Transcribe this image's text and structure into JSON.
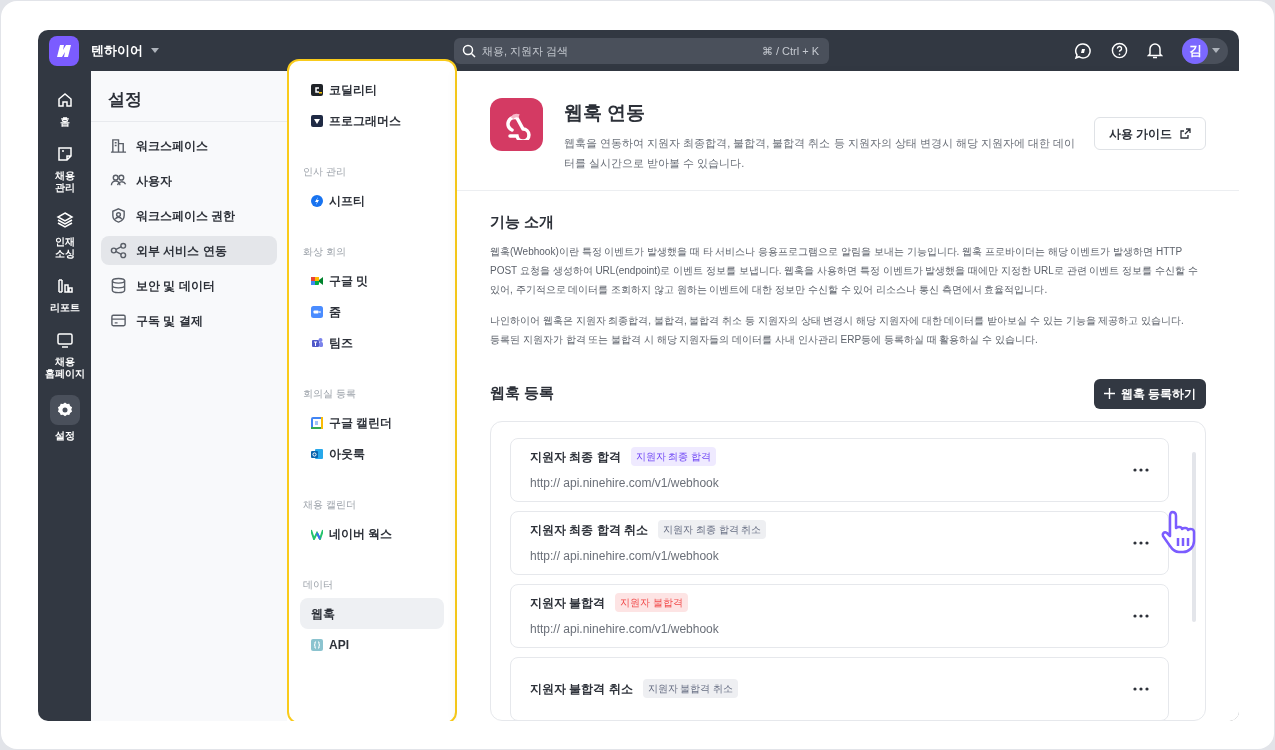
{
  "top_bar": {
    "workspace": "텐하이어",
    "search": {
      "placeholder": "채용, 지원자 검색",
      "shortcut": "⌘ / Ctrl + K"
    },
    "avatar": "김"
  },
  "rail": [
    {
      "label": "홈",
      "selected": false
    },
    {
      "label": "채용 관리",
      "selected": false
    },
    {
      "label": "인재 소싱",
      "selected": false
    },
    {
      "label": "리포트",
      "selected": false
    },
    {
      "label": "채용 홈페이지",
      "selected": false
    },
    {
      "label": "설정",
      "selected": true
    }
  ],
  "settings": {
    "title": "설정",
    "items": [
      {
        "label": "워크스페이스",
        "selected": false
      },
      {
        "label": "사용자",
        "selected": false
      },
      {
        "label": "워크스페이스 권한",
        "selected": false
      },
      {
        "label": "외부 서비스 연동",
        "selected": true
      },
      {
        "label": "보안 및 데이터",
        "selected": false
      },
      {
        "label": "구독 및 결제",
        "selected": false
      }
    ]
  },
  "integrations": [
    {
      "items": [
        {
          "label": "코딜리티",
          "selected": false
        },
        {
          "label": "프로그래머스",
          "selected": false
        }
      ]
    },
    {
      "heading": "인사 관리",
      "items": [
        {
          "label": "시프티",
          "selected": false
        }
      ]
    },
    {
      "heading": "화상 회의",
      "items": [
        {
          "label": "구글 밋",
          "selected": false
        },
        {
          "label": "줌",
          "selected": false
        },
        {
          "label": "팀즈",
          "selected": false
        }
      ]
    },
    {
      "heading": "회의실 등록",
      "items": [
        {
          "label": "구글 캘린더",
          "selected": false
        },
        {
          "label": "아웃룩",
          "selected": false
        }
      ]
    },
    {
      "heading": "채용 캘린더",
      "items": [
        {
          "label": "네이버 웍스",
          "selected": false
        }
      ]
    },
    {
      "heading": "데이터",
      "items": [
        {
          "label": "웹훅",
          "selected": true
        },
        {
          "label": "API",
          "selected": false
        }
      ]
    }
  ],
  "header": {
    "title": "웹훅 연동",
    "description": "웹훅을 연동하여 지원자 최종합격, 불합격, 불합격 취소 등 지원자의 상태 변경시 해당 지원자에 대한 데이터를 실시간으로 받아볼 수 있습니다.",
    "guide_button": "사용 가이드"
  },
  "intro": {
    "heading": "기능 소개",
    "paragraphs": [
      "웹훅(Webhook)이란 특정 이벤트가 발생했을 때 타 서비스나 응용프로그램으로 알림을 보내는 기능입니다. 웹훅 프로바이더는 해당 이벤트가 발생하면 HTTP POST 요청을 생성하여 URL(endpoint)로 이벤트 정보를 보냅니다. 웹훅을 사용하면 특정 이벤트가 발생했을 때에만 지정한 URL로 관련 이벤트 정보를 수신할 수 있어, 주기적으로 데이터를 조회하지 않고 원하는 이벤트에 대한 정보만 수신할 수 있어 리소스나 통신 측면에서 효율적입니다.",
      "나인하이어 웹훅은 지원자 최종합격, 불합격, 불합격 취소 등 지원자의 상태 변경시 해당 지원자에 대한 데이터를 받아보실 수 있는 기능을 제공하고 있습니다.\n등록된 지원자가 합격 또는 불합격 시 해당 지원자들의 데이터를 사내 인사관리 ERP등에 등록하실 때 활용하실 수 있습니다."
    ]
  },
  "webhooks": {
    "heading": "웹훅 등록",
    "add_button": "웹훅 등록하기",
    "cards": [
      {
        "title": "지원자 최종 합격",
        "tag": "지원자 최종 합격",
        "color": "#efeaff",
        "url": "http:// api.ninehire.com/v1/webhook"
      },
      {
        "title": "지원자 최종 합격 취소",
        "tag": "지원자 최종 합격 취소",
        "color": "#eeeff2",
        "url": "http:// api.ninehire.com/v1/webhook"
      },
      {
        "title": "지원자 불합격",
        "tag": "지원자 불합격",
        "color": "#fde4e4",
        "url": "http:// api.ninehire.com/v1/webhook"
      },
      {
        "title": "지원자 불합격 취소",
        "tag": "지원자 불합격 취소",
        "color": "#eeeff2"
      }
    ]
  }
}
